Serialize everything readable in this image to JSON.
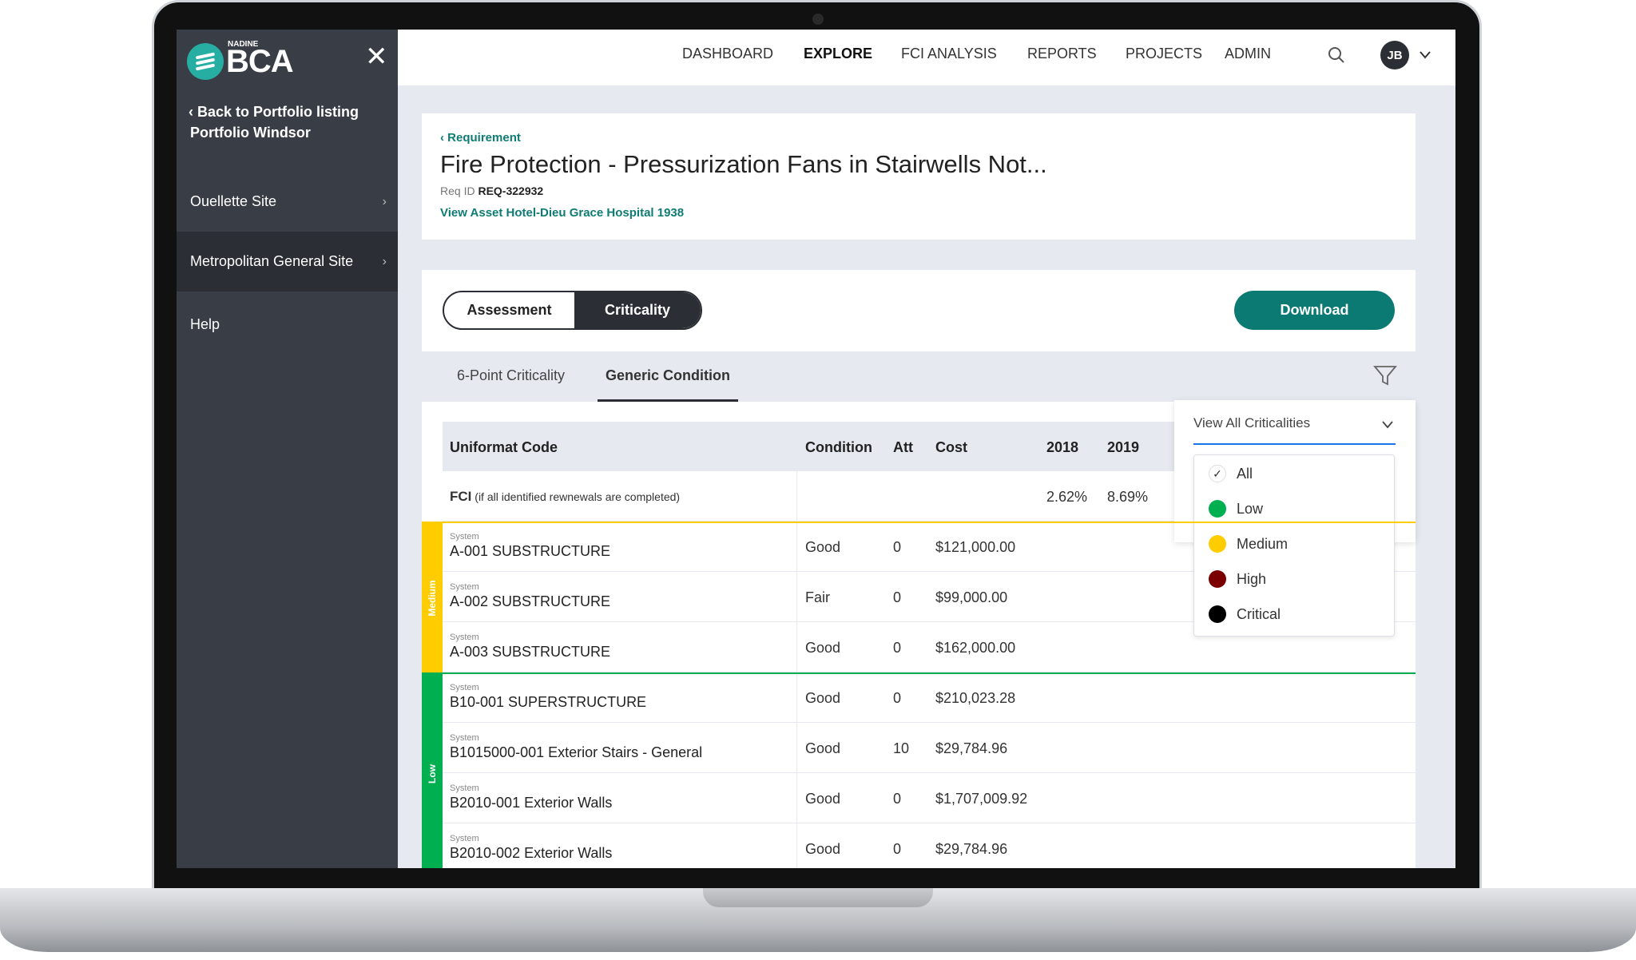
{
  "brand": {
    "small": "NADINE",
    "name": "BCA",
    "accent": "#27aea3"
  },
  "sidebar": {
    "back_label": "Back to Portfolio listing",
    "portfolio": "Portfolio Windsor",
    "items": [
      {
        "label": "Ouellette Site"
      },
      {
        "label": "Metropolitan General Site"
      },
      {
        "label": "Help"
      }
    ]
  },
  "nav": {
    "items": [
      "DASHBOARD",
      "EXPLORE",
      "FCI ANALYSIS",
      "REPORTS",
      "PROJECTS",
      "ADMIN"
    ],
    "active": "EXPLORE",
    "avatar": "JB"
  },
  "header": {
    "breadcrumb": "Requirement",
    "title": "Fire Protection - Pressurization Fans in Stairwells Not...",
    "req_id_label": "Req ID",
    "req_id": "REQ-322932",
    "asset_link": "View Asset Hotel-Dieu Grace Hospital 1938"
  },
  "toggle": {
    "options": [
      "Assessment",
      "Criticality"
    ],
    "active": "Criticality"
  },
  "download_label": "Download",
  "subtabs": {
    "items": [
      "6-Point Criticality",
      "Generic Condition"
    ],
    "active": "Generic Condition"
  },
  "table": {
    "columns": [
      "Uniformat Code",
      "Condition",
      "Att",
      "Cost",
      "2018",
      "2019"
    ],
    "fci": {
      "label": "FCI",
      "note": "(if all identified rewnewals are completed)",
      "y2018": "2.62%",
      "y2019": "8.69%"
    },
    "groups": [
      {
        "label": "Medium",
        "color": "#ffcc00",
        "rows": [
          {
            "type": "System",
            "name": "A-001 SUBSTRUCTURE",
            "condition": "Good",
            "att": "0",
            "cost": "$121,000.00"
          },
          {
            "type": "System",
            "name": "A-002 SUBSTRUCTURE",
            "condition": "Fair",
            "att": "0",
            "cost": "$99,000.00"
          },
          {
            "type": "System",
            "name": "A-003 SUBSTRUCTURE",
            "condition": "Good",
            "att": "0",
            "cost": "$162,000.00"
          }
        ]
      },
      {
        "label": "Low",
        "color": "#00b050",
        "rows": [
          {
            "type": "System",
            "name": "B10-001 SUPERSTRUCTURE",
            "condition": "Good",
            "att": "0",
            "cost": "$210,023.28"
          },
          {
            "type": "System",
            "name": "B1015000-001 Exterior Stairs - General",
            "condition": "Good",
            "att": "10",
            "cost": "$29,784.96"
          },
          {
            "type": "System",
            "name": "B2010-001 Exterior Walls",
            "condition": "Good",
            "att": "0",
            "cost": "$1,707,009.92"
          },
          {
            "type": "System",
            "name": "B2010-002 Exterior Walls",
            "condition": "Good",
            "att": "0",
            "cost": "$29,784.96"
          }
        ]
      }
    ]
  },
  "filter": {
    "selected": "View All Criticalities",
    "options": [
      {
        "label": "All",
        "checked": true
      },
      {
        "label": "Low",
        "color": "#00b050"
      },
      {
        "label": "Medium",
        "color": "#ffcc00"
      },
      {
        "label": "High",
        "color": "#7a0000"
      },
      {
        "label": "Critical",
        "color": "#000000"
      }
    ]
  }
}
